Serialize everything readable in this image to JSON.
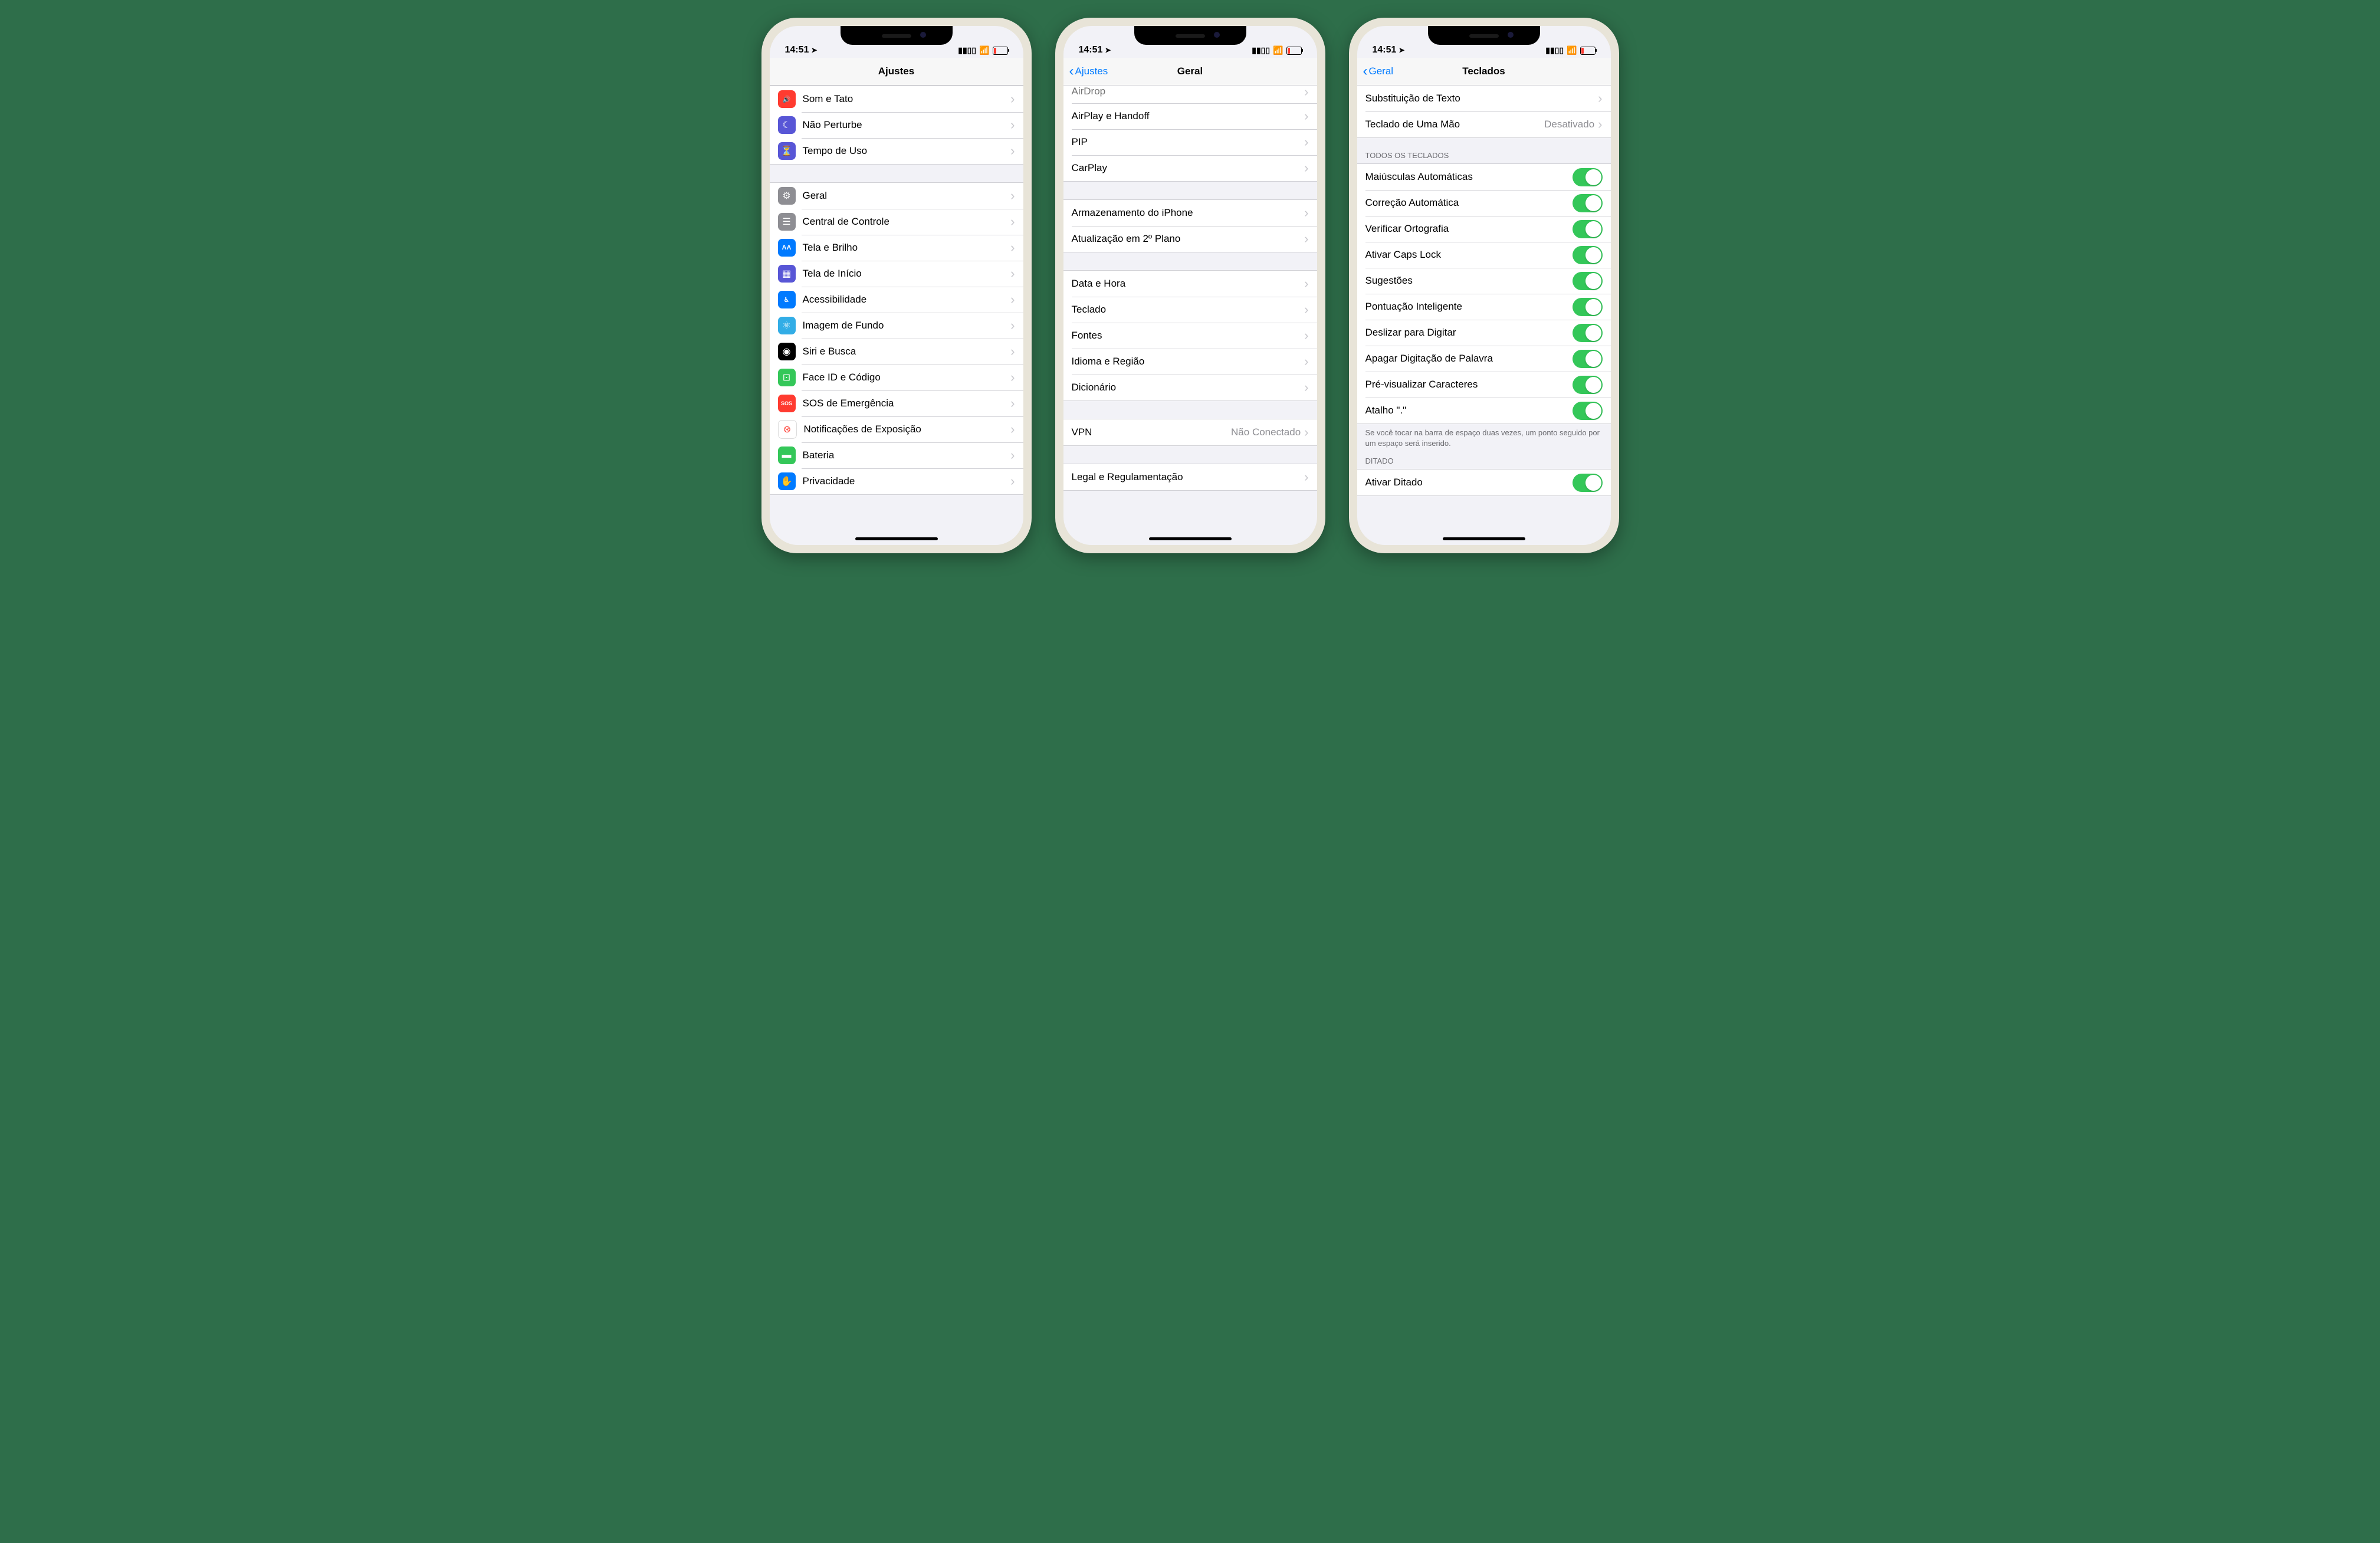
{
  "status": {
    "time": "14:51"
  },
  "phone1": {
    "nav": {
      "title": "Ajustes"
    },
    "groups": [
      [
        {
          "icon": "speaker-wave-icon",
          "bg": "bg-red",
          "glyph": "🔊",
          "label": "Som e Tato"
        },
        {
          "icon": "moon-icon",
          "bg": "bg-indigo",
          "glyph": "☾",
          "label": "Não Perturbe"
        },
        {
          "icon": "hourglass-icon",
          "bg": "bg-indigo",
          "glyph": "⏳",
          "label": "Tempo de Uso"
        }
      ],
      [
        {
          "icon": "gear-icon",
          "bg": "bg-gray",
          "glyph": "⚙",
          "label": "Geral"
        },
        {
          "icon": "switches-icon",
          "bg": "bg-gray",
          "glyph": "☰",
          "label": "Central de Controle"
        },
        {
          "icon": "textformat-icon",
          "bg": "bg-blue",
          "glyph": "AA",
          "label": "Tela e Brilho"
        },
        {
          "icon": "grid-icon",
          "bg": "bg-indigo",
          "glyph": "▦",
          "label": "Tela de Início"
        },
        {
          "icon": "accessibility-icon",
          "bg": "bg-blue",
          "glyph": "♿︎",
          "label": "Acessibilidade"
        },
        {
          "icon": "atom-icon",
          "bg": "bg-teal",
          "glyph": "⚛",
          "label": "Imagem de Fundo"
        },
        {
          "icon": "siri-icon",
          "bg": "bg-black",
          "glyph": "◉",
          "label": "Siri e Busca"
        },
        {
          "icon": "faceid-icon",
          "bg": "bg-green",
          "glyph": "⊡",
          "label": "Face ID e Código"
        },
        {
          "icon": "sos-icon",
          "bg": "bg-red",
          "glyph": "SOS",
          "label": "SOS de Emergência"
        },
        {
          "icon": "virus-icon",
          "bg": "bg-white",
          "glyph": "⊛",
          "label": "Notificações de Exposição"
        },
        {
          "icon": "battery-icon",
          "bg": "bg-green",
          "glyph": "▬",
          "label": "Bateria"
        },
        {
          "icon": "hand-icon",
          "bg": "bg-blue",
          "glyph": "✋",
          "label": "Privacidade"
        }
      ]
    ]
  },
  "phone2": {
    "nav": {
      "back": "Ajustes",
      "title": "Geral"
    },
    "groups": [
      {
        "partial": true,
        "rows": [
          {
            "label": "AirDrop"
          },
          {
            "label": "AirPlay e Handoff"
          },
          {
            "label": "PIP"
          },
          {
            "label": "CarPlay"
          }
        ]
      },
      {
        "rows": [
          {
            "label": "Armazenamento do iPhone"
          },
          {
            "label": "Atualização em 2º Plano"
          }
        ]
      },
      {
        "rows": [
          {
            "label": "Data e Hora"
          },
          {
            "label": "Teclado"
          },
          {
            "label": "Fontes"
          },
          {
            "label": "Idioma e Região"
          },
          {
            "label": "Dicionário"
          }
        ]
      },
      {
        "rows": [
          {
            "label": "VPN",
            "detail": "Não Conectado"
          }
        ]
      },
      {
        "rows": [
          {
            "label": "Legal e Regulamentação"
          }
        ]
      }
    ]
  },
  "phone3": {
    "nav": {
      "back": "Geral",
      "title": "Teclados"
    },
    "topRows": [
      {
        "label": "Substituição de Texto"
      },
      {
        "label": "Teclado de Uma Mão",
        "detail": "Desativado"
      }
    ],
    "toggleHeader": "TODOS OS TECLADOS",
    "toggles": [
      "Maiúsculas Automáticas",
      "Correção Automática",
      "Verificar Ortografia",
      "Ativar Caps Lock",
      "Sugestões",
      "Pontuação Inteligente",
      "Deslizar para Digitar",
      "Apagar Digitação de Palavra",
      "Pré-visualizar Caracteres",
      "Atalho \".\""
    ],
    "toggleFooter": "Se você tocar na barra de espaço duas vezes, um ponto seguido por um espaço será inserido.",
    "dictationHeader": "DITADO",
    "dictationRow": "Ativar Ditado"
  }
}
